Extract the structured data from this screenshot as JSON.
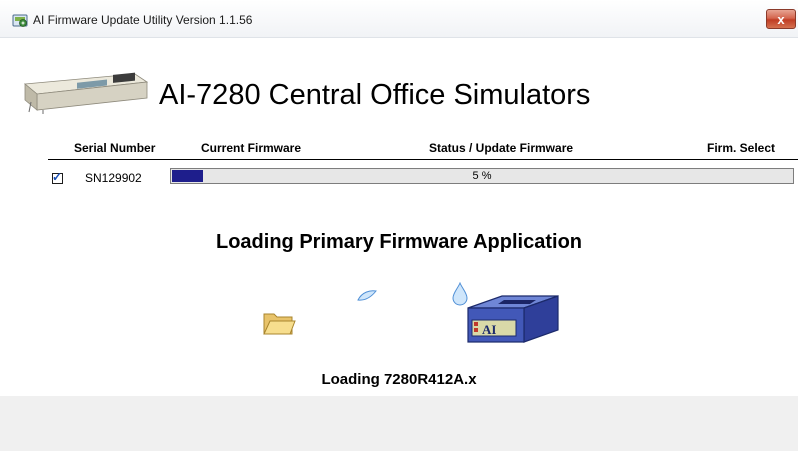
{
  "window": {
    "title": "AI Firmware Update Utility Version 1.1.56",
    "close_label": "x"
  },
  "header": {
    "product_title": "AI-7280 Central Office Simulators"
  },
  "table": {
    "columns": [
      "Serial Number",
      "Current Firmware",
      "Status / Update Firmware",
      "Firm. Select"
    ],
    "rows": [
      {
        "checked": true,
        "serial": "SN129902",
        "progress_text": "5 %",
        "progress_percent": 5
      }
    ]
  },
  "status": {
    "heading": "Loading Primary Firmware Application",
    "file_text": "Loading 7280R412A.x"
  },
  "colors": {
    "progress_fill": "#1e1e8c",
    "progress_track": "#e7e7e7",
    "footer_bg": "#f0f0f0",
    "close_button": "#c9503a"
  },
  "icons": {
    "app": "app-icon",
    "source": "folder-icon",
    "transfer": "data-drop-icon",
    "target": "ai-device-icon"
  }
}
